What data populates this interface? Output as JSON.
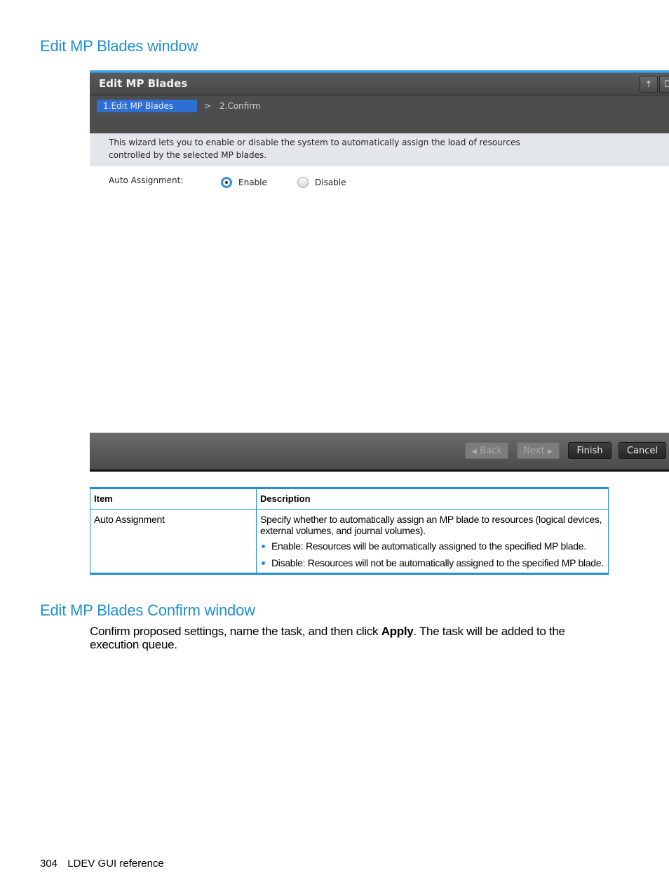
{
  "section1": {
    "heading": "Edit MP Blades window"
  },
  "window": {
    "title": "Edit MP Blades",
    "title_buttons": [
      {
        "icon": "pin-icon",
        "glyph": "⤒"
      },
      {
        "icon": "maximize-icon",
        "glyph": "☐"
      }
    ],
    "steps": {
      "active": "1.Edit MP Blades",
      "separator": ">",
      "next": "2.Confirm"
    },
    "description": "This wizard lets you to enable or disable the system to automatically assign the load of resources controlled by the selected MP blades.",
    "field": {
      "label": "Auto Assignment:",
      "options": [
        {
          "label": "Enable",
          "selected": true
        },
        {
          "label": "Disable",
          "selected": false
        }
      ]
    },
    "footer_buttons": {
      "back": {
        "label": "Back",
        "enabled": false,
        "icon": "◀"
      },
      "next": {
        "label": "Next",
        "enabled": false,
        "icon": "▶"
      },
      "finish": {
        "label": "Finish",
        "enabled": true
      },
      "cancel": {
        "label": "Cancel",
        "enabled": true
      }
    }
  },
  "table": {
    "headers": [
      "Item",
      "Description"
    ],
    "rows": [
      {
        "item": "Auto Assignment",
        "description": "Specify whether to automatically assign an MP blade to resources (logical devices, external volumes, and journal volumes).",
        "bullets": [
          "Enable: Resources will be automatically assigned to the specified MP blade.",
          "Disable: Resources will not be automatically assigned to the specified MP blade."
        ]
      }
    ]
  },
  "section2": {
    "heading": "Edit MP Blades Confirm window",
    "para_before": "Confirm proposed settings, name the task, and then click ",
    "para_bold": "Apply",
    "para_after": ". The task will be added to the execution queue."
  },
  "page_footer": {
    "page_number": "304",
    "title": "LDEV GUI reference"
  },
  "colors": {
    "accent": "#1e8fd0",
    "step_active": "#2e6fd4",
    "window_chrome": "#4d4d4d"
  }
}
